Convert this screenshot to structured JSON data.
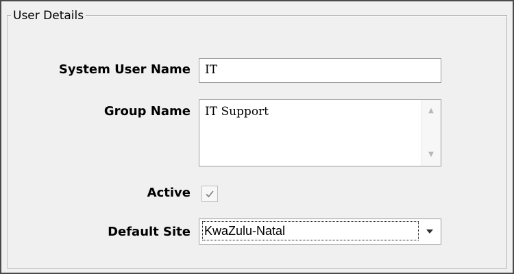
{
  "group": {
    "title": "User Details"
  },
  "fields": {
    "system_user_name": {
      "label": "System User Name",
      "value": "IT"
    },
    "group_name": {
      "label": "Group Name",
      "value": "IT Support"
    },
    "active": {
      "label": "Active",
      "checked": true
    },
    "default_site": {
      "label": "Default Site",
      "value": "KwaZulu-Natal"
    }
  },
  "icons": {
    "scroll_up": "chevron-up-icon",
    "scroll_down": "chevron-down-icon",
    "checkmark": "checkmark-icon",
    "dropdown": "chevron-down-icon"
  },
  "colors": {
    "window_border": "#4a4a4a",
    "background": "#f0f0f0",
    "input_border": "#9a9a9a",
    "disabled_glyph": "#b7b7b7"
  }
}
